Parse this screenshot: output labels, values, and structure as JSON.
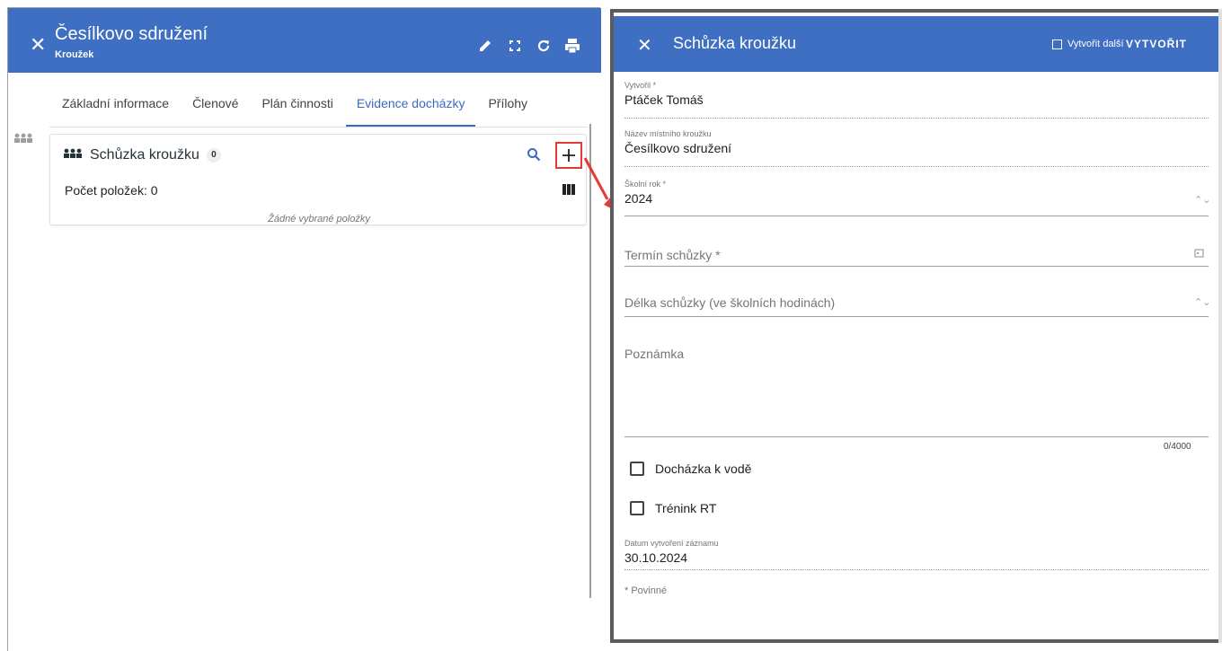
{
  "left": {
    "header": {
      "title": "Česílkovo sdružení",
      "subtitle": "Kroužek"
    },
    "tabs": [
      {
        "label": "Základní informace"
      },
      {
        "label": "Členové"
      },
      {
        "label": "Plán činnosti"
      },
      {
        "label": "Evidence docházky",
        "active": true
      },
      {
        "label": "Přílohy"
      }
    ],
    "card": {
      "title": "Schůzka kroužku",
      "badge": "0",
      "count_text": "Počet položek: 0",
      "empty_text": "Žádné vybrané položky"
    }
  },
  "dialog": {
    "title": "Schůzka kroužku",
    "create_another_label": "Vytvořit další",
    "create_label": "VYTVOŘIT",
    "fields": {
      "created_by": {
        "label": "Vytvořil *",
        "value": "Ptáček Tomáš"
      },
      "club_name": {
        "label": "Název místního kroužku",
        "value": "Česílkovo sdružení"
      },
      "school_year": {
        "label": "Školní rok *",
        "value": "2024"
      },
      "meeting_date": {
        "placeholder": "Termín schůzky *"
      },
      "meeting_length": {
        "placeholder": "Délka schůzky (ve školních hodinách)"
      },
      "note": {
        "placeholder": "Poznámka",
        "counter": "0/4000"
      },
      "water_attendance": {
        "label": "Docházka k vodě"
      },
      "training_rt": {
        "label": "Trénink RT"
      },
      "created_date": {
        "label": "Datum vytvoření záznamu",
        "value": "30.10.2024"
      }
    },
    "required_note": "* Povinné"
  },
  "colors": {
    "header_blue": "#3f6fc2",
    "highlight_red": "#e53935",
    "tab_active": "#3b6bc0"
  }
}
